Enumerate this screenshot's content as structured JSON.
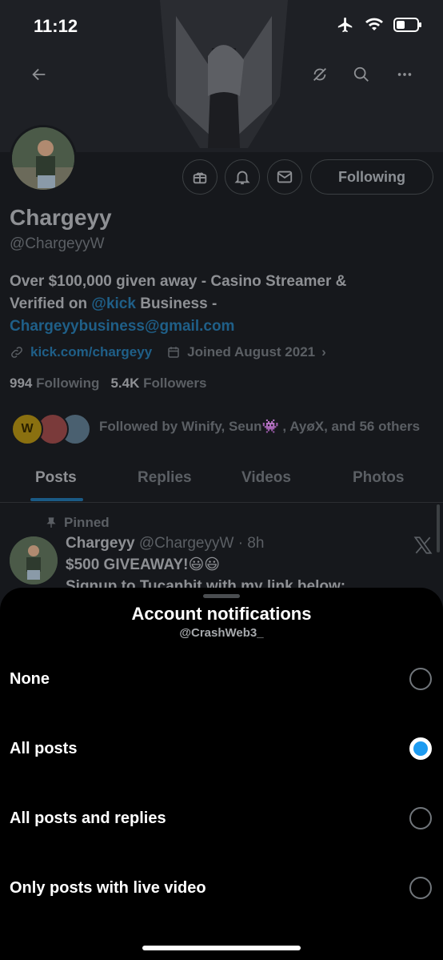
{
  "status_bar": {
    "time": "11:12"
  },
  "profile": {
    "name": "Chargeyy",
    "handle": "@ChargeyyW",
    "following_button": "Following",
    "bio_1": "Over $100,000 given away - Casino Streamer &",
    "bio_2_prefix": "Verified on ",
    "bio_2_mention": "@kick",
    "bio_2_suffix": " Business -",
    "bio_email": "Chargeyybusiness@gmail.com",
    "website": "kick.com/chargeyy",
    "joined": "Joined August 2021",
    "following_count": "994",
    "following_label": "Following",
    "followers_count": "5.4K",
    "followers_label": "Followers",
    "followed_by": "Followed by Winify, Seun👾 , AyøX, and 56 others"
  },
  "tabs": [
    "Posts",
    "Replies",
    "Videos",
    "Photos"
  ],
  "post": {
    "pinned_label": "Pinned",
    "author": "Chargeyy",
    "meta": "@ChargeyyW · 8h",
    "text_1": "$500 GIVEAWAY!😃😃",
    "text_2": "Signup to Tucanbit with my link below:"
  },
  "sheet": {
    "title": "Account notifications",
    "subtitle": "@CrashWeb3_",
    "options": [
      {
        "label": "None",
        "selected": false
      },
      {
        "label": "All posts",
        "selected": true
      },
      {
        "label": "All posts and replies",
        "selected": false
      },
      {
        "label": "Only posts with live video",
        "selected": false
      }
    ]
  },
  "colors": {
    "accent": "#1d9bf0",
    "sheet_bg": "#000000",
    "page_bg": "#16181c"
  },
  "icons": [
    "back-arrow-icon",
    "refresh-icon",
    "search-icon",
    "more-icon",
    "gift-icon",
    "bell-icon",
    "mail-icon",
    "link-icon",
    "calendar-icon",
    "pin-icon",
    "x-logo-icon",
    "airplane-icon",
    "wifi-icon",
    "battery-icon"
  ]
}
